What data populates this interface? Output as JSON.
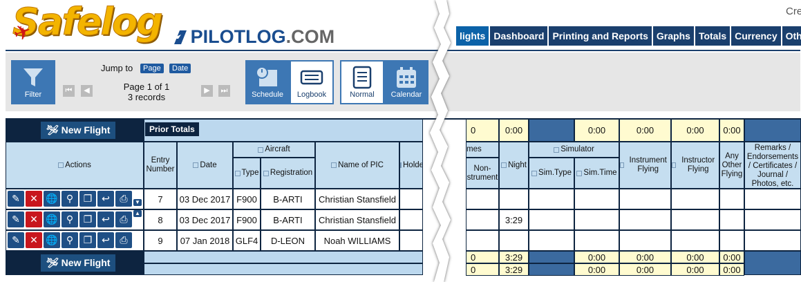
{
  "header": {
    "logo_text": "Safelog",
    "pilotlog_brand": "PILOTLOG",
    "pilotlog_tld": ".COM",
    "top_right_text": "Cre"
  },
  "nav": {
    "tabs": [
      {
        "label": "lights",
        "active": true
      },
      {
        "label": "Dashboard"
      },
      {
        "label": "Printing and Reports"
      },
      {
        "label": "Graphs"
      },
      {
        "label": "Totals"
      },
      {
        "label": "Currency"
      },
      {
        "label": "Other t"
      }
    ]
  },
  "toolbar": {
    "filter_label": "Filter",
    "jump_to_label": "Jump to",
    "jump_page": "Page",
    "jump_date": "Date",
    "page_info": "Page 1 of 1",
    "records_info": "3 records",
    "schedule_label": "Schedule",
    "logbook_label": "Logbook",
    "normal_label": "Normal",
    "calendar_label": "Calendar"
  },
  "table": {
    "new_flight_label": "New Flight",
    "prior_totals_label": "Prior Totals",
    "headers": {
      "actions": "Actions",
      "entry_number": "Entry Number",
      "date": "Date",
      "aircraft": "Aircraft",
      "type": "Type",
      "registration": "Registration",
      "name_of_pic": "Name of PIC",
      "holder_capacity": "Holder Operating Capacity",
      "times": "mes",
      "non_instrument": "Non-\nstrument",
      "night": "Night",
      "simulator": "Simulator",
      "sim_type": "Sim.Type",
      "sim_time": "Sim.Time",
      "instrument_flying": "Instrument Flying",
      "instructor_flying": "Instructor Flying",
      "any_other_flying": "Any Other Flying",
      "remarks": "Remarks / Endorsements / Certificates / Journal / Photos, etc."
    },
    "prior_values": {
      "col_a": "0",
      "night": "0:00",
      "sim_time": "0:00",
      "instrument": "0:00",
      "instructor": "0:00",
      "other": "0:00"
    },
    "rows": [
      {
        "entry": "7",
        "date": "03 Dec 2017",
        "type": "F900",
        "registration": "B-ARTI",
        "pic": "Christian Stansfield",
        "night": ""
      },
      {
        "entry": "8",
        "date": "03 Dec 2017",
        "type": "F900",
        "registration": "B-ARTI",
        "pic": "Christian Stansfield",
        "night": "3:29"
      },
      {
        "entry": "9",
        "date": "07 Jan 2018",
        "type": "GLF4",
        "registration": "D-LEON",
        "pic": "Noah WILLIAMS",
        "night": ""
      }
    ],
    "totals_rows": [
      {
        "col_a": "0",
        "night": "3:29",
        "sim_time": "0:00",
        "instrument": "0:00",
        "instructor": "0:00",
        "other": "0:00"
      },
      {
        "col_a": "0",
        "night": "3:29",
        "sim_time": "0:00",
        "instrument": "0:00",
        "instructor": "0:00",
        "other": "0:00"
      }
    ]
  }
}
